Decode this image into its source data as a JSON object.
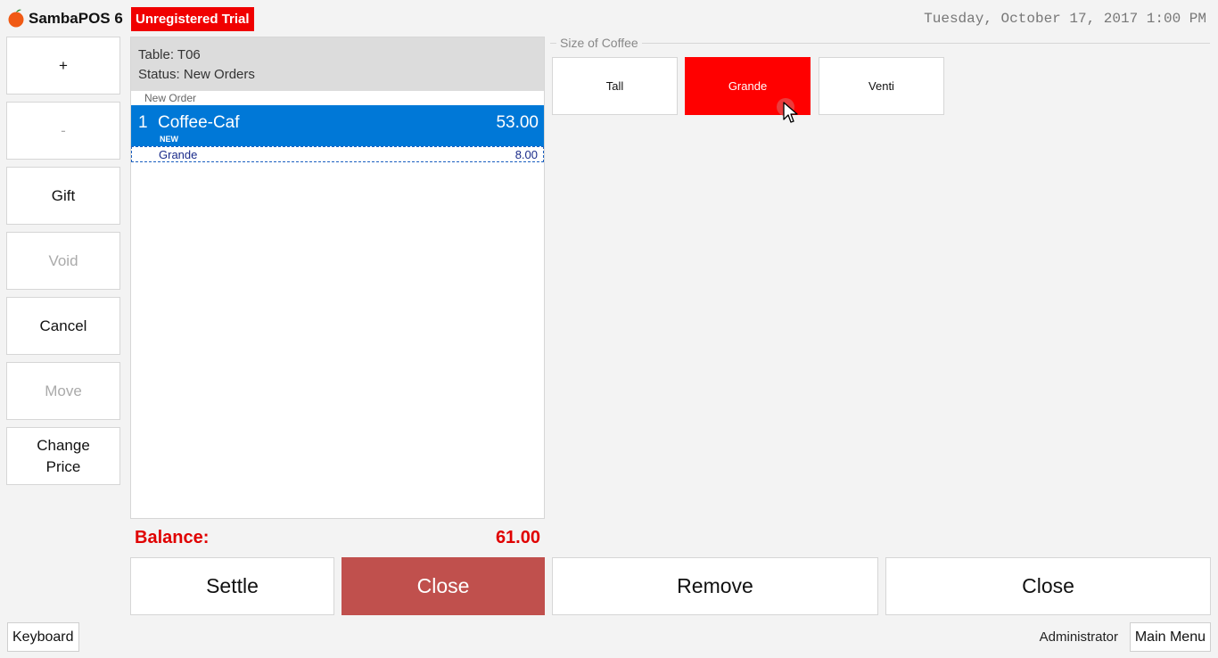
{
  "header": {
    "app_title": "SambaPOS 6",
    "trial_badge": "Unregistered Trial",
    "datetime": "Tuesday, October 17, 2017 1:00 PM"
  },
  "side_buttons": {
    "plus": "+",
    "minus": "-",
    "gift": "Gift",
    "void": "Void",
    "cancel": "Cancel",
    "move": "Move",
    "change_price_line1": "Change",
    "change_price_line2": "Price"
  },
  "ticket": {
    "table": "Table: T06",
    "status": "Status: New Orders",
    "group_label": "New Order",
    "order": {
      "qty": "1",
      "name": "Coffee-Caf",
      "price": "53.00",
      "tag": "NEW"
    },
    "modifier": {
      "name": "Grande",
      "price": "8.00"
    }
  },
  "balance": {
    "label": "Balance:",
    "value": "61.00"
  },
  "bottom_buttons": {
    "settle": "Settle",
    "close_ticket": "Close",
    "remove": "Remove",
    "close": "Close"
  },
  "size_group": {
    "title": "Size of Coffee",
    "options": [
      "Tall",
      "Grande",
      "Venti"
    ],
    "selected": "Grande",
    "selected_color": "#ff0000"
  },
  "footer": {
    "keyboard": "Keyboard",
    "user": "Administrator",
    "main_menu": "Main Menu"
  },
  "colors": {
    "accent_blue": "#0078d7",
    "trial_red": "#f00000",
    "close_red": "#c0504d",
    "balance_red": "#e00000"
  }
}
